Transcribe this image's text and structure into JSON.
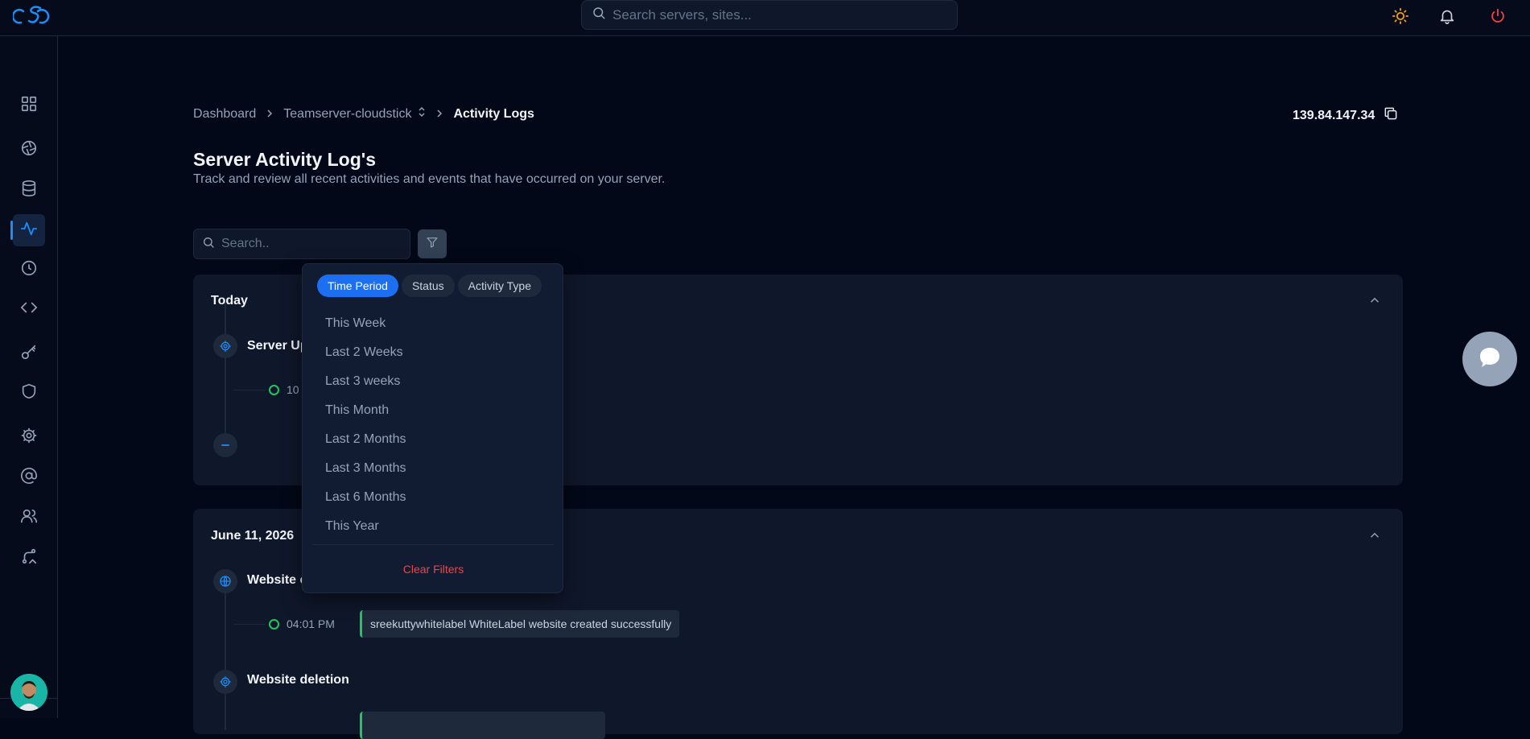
{
  "topbar": {
    "search_placeholder": "Search servers, sites...",
    "icons": [
      "logo",
      "search-icon",
      "sun-icon",
      "bell-icon",
      "power-icon"
    ],
    "colors": {
      "sun": "#f59e0b",
      "power": "#ef4444",
      "logo": "#1d8cf8"
    }
  },
  "sidebar": {
    "items": [
      {
        "name": "dashboard",
        "icon": "grid-icon"
      },
      {
        "name": "sites",
        "icon": "aperture-icon"
      },
      {
        "name": "databases",
        "icon": "database-icon"
      },
      {
        "name": "activity",
        "icon": "activity-icon",
        "active": true
      },
      {
        "name": "cron",
        "icon": "clock-icon"
      },
      {
        "name": "code",
        "icon": "code-icon"
      },
      {
        "name": "keys",
        "icon": "key-icon"
      },
      {
        "name": "security",
        "icon": "shield-icon"
      },
      {
        "name": "settings",
        "icon": "gear-icon"
      },
      {
        "name": "email",
        "icon": "at-icon"
      },
      {
        "name": "team",
        "icon": "users-icon"
      },
      {
        "name": "routes",
        "icon": "route-icon"
      }
    ]
  },
  "breadcrumb": {
    "items": [
      "Dashboard",
      "Teamserver-cloudstick",
      "Activity Logs"
    ]
  },
  "server_ip": "139.84.147.34",
  "page": {
    "title": "Server Activity Log's",
    "subtitle": "Track and review all recent activities and events that have occurred on your server.",
    "search_placeholder": "Search.."
  },
  "groups": [
    {
      "date": "Today",
      "events": [
        {
          "title": "Server Up",
          "time": "10"
        }
      ]
    },
    {
      "date": "June 11, 2026",
      "events": [
        {
          "title": "Website c",
          "time": "04:01 PM",
          "message": "sreekuttywhitelabel WhiteLabel website created successfully"
        },
        {
          "title": "Website deletion"
        }
      ]
    }
  ],
  "filter_dropdown": {
    "tabs": [
      "Time Period",
      "Status",
      "Activity Type"
    ],
    "active_tab": "Time Period",
    "options": [
      "This Week",
      "Last 2 Weeks",
      "Last 3 weeks",
      "This Month",
      "Last 2 Months",
      "Last 3 Months",
      "Last 6 Months",
      "This Year"
    ],
    "clear_label": "Clear Filters"
  },
  "colors": {
    "accent": "#1d6ff2",
    "success": "#22c55e",
    "danger": "#ef4444"
  }
}
